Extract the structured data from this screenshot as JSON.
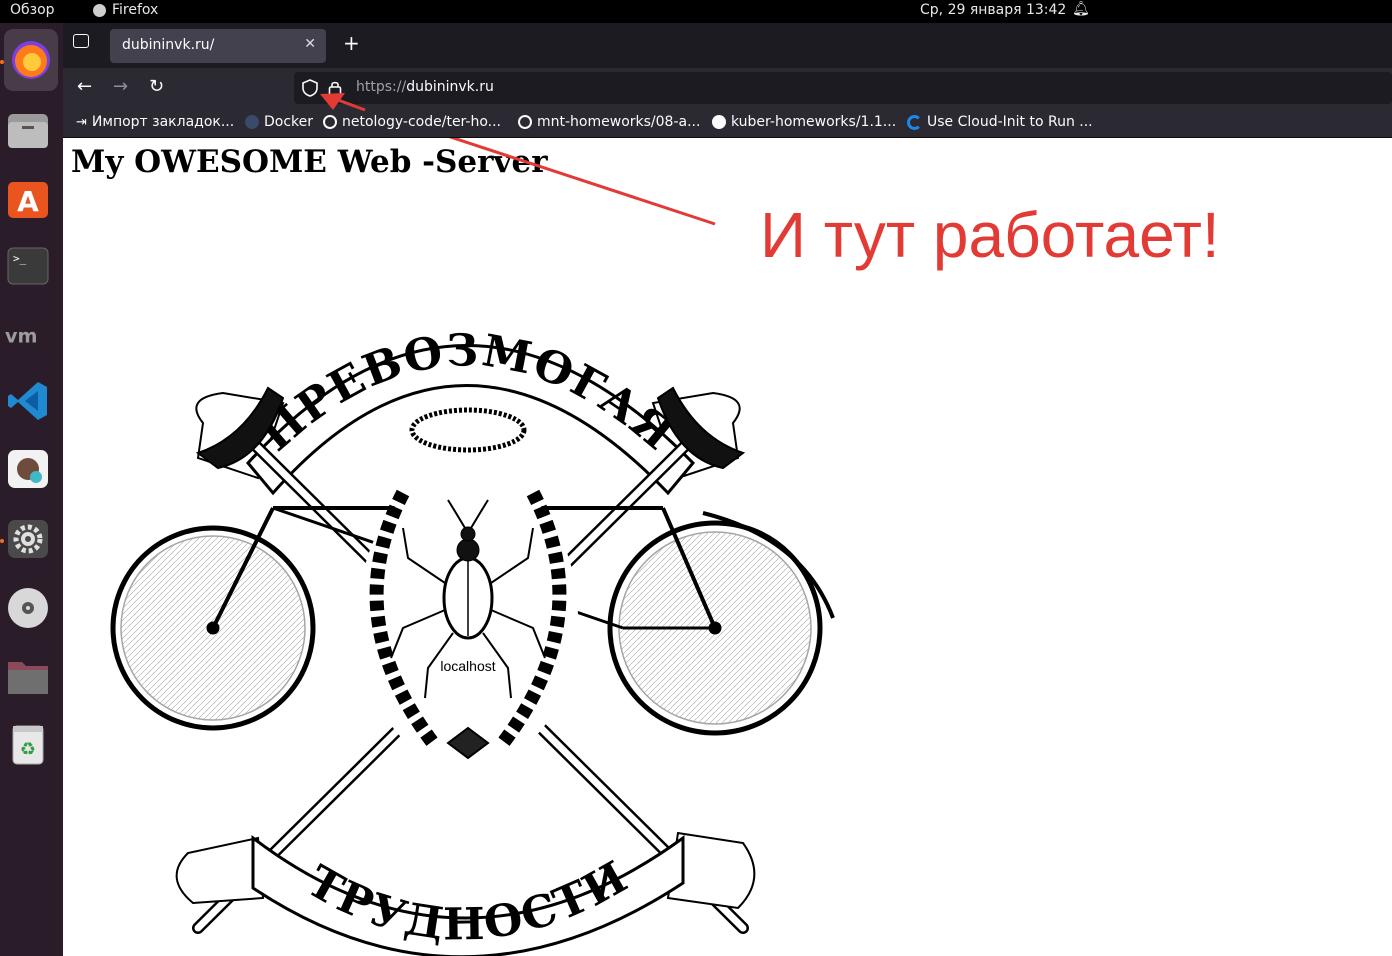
{
  "topbar": {
    "overview": "Обзор",
    "app_name": "Firefox",
    "clock": "Ср, 29 января  13:42"
  },
  "dock": {
    "items": [
      "firefox-icon",
      "files-icon",
      "app-center-icon",
      "terminal-icon",
      "vmware-icon",
      "vscode-icon",
      "dbeaver-icon",
      "settings-icon",
      "disc-icon",
      "folder-icon",
      "trash-icon"
    ]
  },
  "browser": {
    "tab_title": "dubininvk.ru/",
    "url_protocol": "https://",
    "url_host": "dubininvk.ru",
    "bookmarks": [
      "Импорт закладок...",
      "Docker",
      "netology-code/ter-ho...",
      "mnt-homeworks/08-a...",
      "kuber-homeworks/1.1...",
      "Use Cloud-Init to Run ..."
    ]
  },
  "page": {
    "heading": "My OWESOME Web -Server",
    "banner_top": "ПРЕВОЗМОГАЯ",
    "banner_bottom": "ТРУДНОСТИ",
    "center_label": "localhost"
  },
  "annotation": {
    "text": "И тут работает!",
    "color": "#e23b36"
  }
}
